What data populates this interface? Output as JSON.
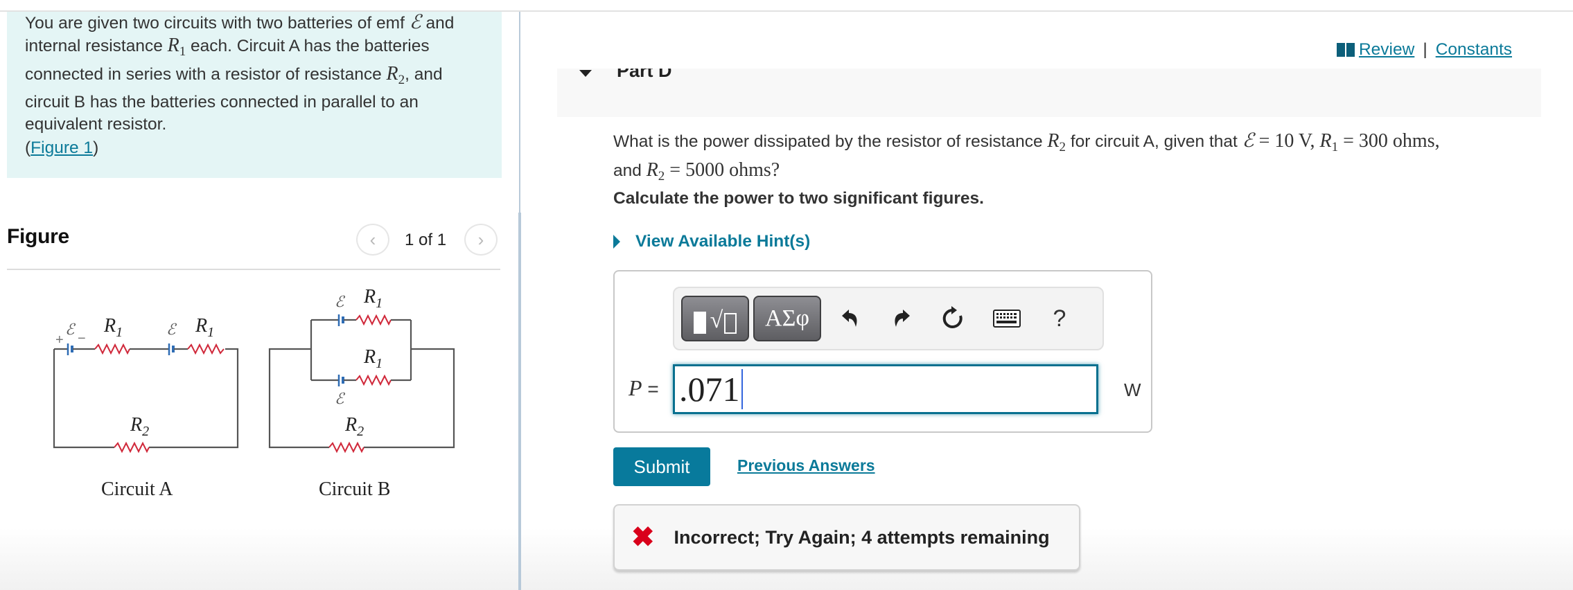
{
  "intro": {
    "line1_pre": "You are given two circuits with two batteries of emf ",
    "emf_symbol": "ℰ",
    "line1_post": " and",
    "line2_pre": "internal resistance ",
    "r1_base": "R",
    "r1_sub": "1",
    "line2_post": " each. Circuit A has the batteries",
    "line3_pre": "connected in series with a resistor of resistance ",
    "r2_base": "R",
    "r2_sub": "2",
    "line3_post": ", and",
    "line4": "circuit B has the batteries connected in parallel to an",
    "line5": "equivalent resistor.",
    "figure_link_open": "(",
    "figure_link": "Figure 1",
    "figure_link_close": ")"
  },
  "figure": {
    "title": "Figure",
    "pager_prev_icon": "chevron-left-icon",
    "pager_count": "1 of 1",
    "pager_next_icon": "chevron-right-icon",
    "circuit_a_label": "Circuit A",
    "circuit_b_label": "Circuit B",
    "emf_label": "ℰ",
    "r1_label": "R",
    "r1_sub": "1",
    "r2_label": "R",
    "r2_sub": "2",
    "plus": "+",
    "minus": "−",
    "colors": {
      "wire": "#555555",
      "resistor": "#d0283a",
      "battery": "#2f6db5"
    }
  },
  "header": {
    "review_label": "Review",
    "separator": "|",
    "constants_label": "Constants"
  },
  "part": {
    "title": "Part D",
    "question_pre": "What is the power dissipated by the resistor of resistance ",
    "q_r2_base": "R",
    "q_r2_sub": "2",
    "question_mid": " for circuit A, given that ",
    "q_emf": "ℰ",
    "q_emf_value": " = 10  V",
    "q_comma": ", ",
    "q_r1_base": "R",
    "q_r1_sub": "1",
    "q_r1_value": " = 300 ohms",
    "q_comma2": ",",
    "question_line2_pre": "and ",
    "q2_r2_base": "R",
    "q2_r2_sub": "2",
    "q2_r2_value": " = 5000 ohms",
    "q2_end": "?",
    "instruction": "Calculate the power to two significant figures.",
    "hint_label": "View Available Hint(s)"
  },
  "answer": {
    "toolbar": {
      "templates_icon": "templates-icon",
      "greek_label": "ΑΣφ",
      "undo_icon": "↶",
      "redo_icon": "↷",
      "reset_icon": "↻",
      "keyboard_icon": "⌨",
      "help_label": "?"
    },
    "variable": "P",
    "equals": " =",
    "value": ".071",
    "unit": "W"
  },
  "actions": {
    "submit_label": "Submit",
    "previous_answers_label": "Previous Answers"
  },
  "feedback": {
    "icon": "✖",
    "text": "Incorrect; Try Again; 4 attempts remaining",
    "accent": "#d9001b"
  }
}
